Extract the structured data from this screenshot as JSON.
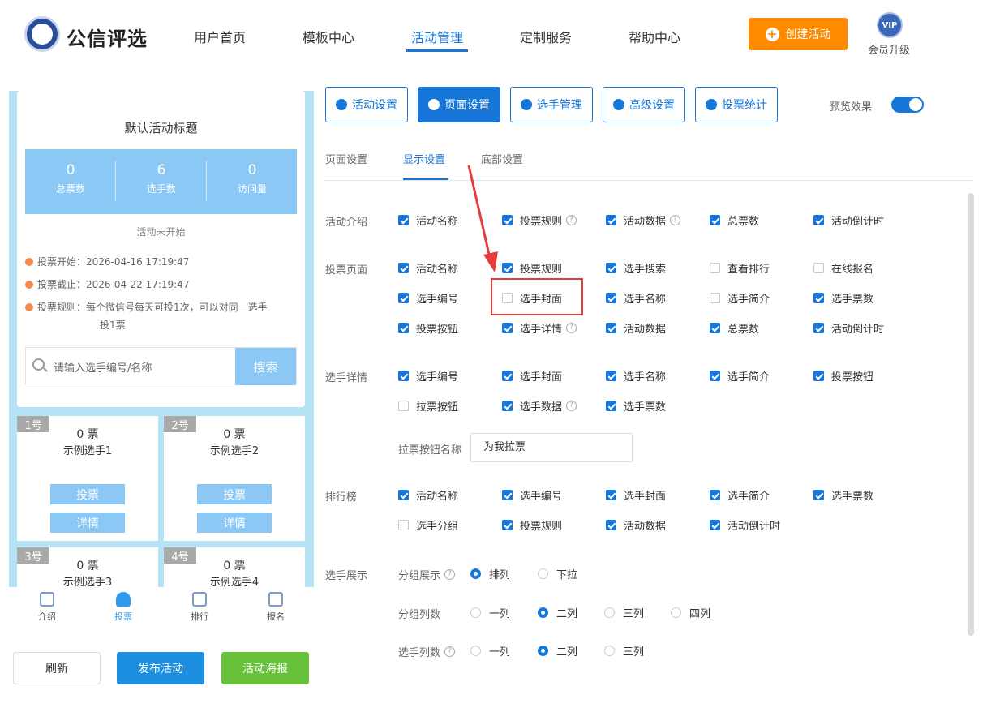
{
  "header": {
    "logo_text": "公信评选",
    "nav": [
      "用户首页",
      "模板中心",
      "活动管理",
      "定制服务",
      "帮助中心"
    ],
    "create_button": "创建活动",
    "vip_badge": "VIP",
    "vip_label": "会员升级"
  },
  "preview": {
    "title": "默认活动标题",
    "stats": [
      {
        "num": "0",
        "label": "总票数"
      },
      {
        "num": "6",
        "label": "选手数"
      },
      {
        "num": "0",
        "label": "访问量"
      }
    ],
    "status": "活动未开始",
    "vote_start": "投票开始：2026-04-16 17:19:47",
    "vote_end": "投票截止：2026-04-22 17:19:47",
    "vote_rule_1": "投票规则：每个微信号每天可投1次，可以对同一选手",
    "vote_rule_2": "投1票",
    "search_placeholder": "请输入选手编号/名称",
    "search_button": "搜索",
    "players": [
      {
        "num": "1号",
        "votes": "0 票",
        "name": "示例选手1",
        "vote_btn": "投票",
        "detail_btn": "详情"
      },
      {
        "num": "2号",
        "votes": "0 票",
        "name": "示例选手2",
        "vote_btn": "投票",
        "detail_btn": "详情"
      },
      {
        "num": "3号",
        "votes": "0 票",
        "name": "示例选手3"
      },
      {
        "num": "4号",
        "votes": "0 票",
        "name": "示例选手4"
      }
    ],
    "tabbar": [
      "介绍",
      "投票",
      "排行",
      "报名"
    ]
  },
  "bottom_buttons": {
    "refresh": "刷新",
    "publish": "发布活动",
    "poster": "活动海报"
  },
  "top_tabs": [
    "活动设置",
    "页面设置",
    "选手管理",
    "高级设置",
    "投票统计"
  ],
  "preview_toggle": {
    "label": "预览效果",
    "on": true
  },
  "sub_tabs": [
    "页面设置",
    "显示设置",
    "底部设置"
  ],
  "sections": {
    "activity_intro": {
      "label": "活动介绍",
      "items": [
        {
          "label": "活动名称",
          "checked": true
        },
        {
          "label": "投票规则",
          "checked": true,
          "help": true
        },
        {
          "label": "活动数据",
          "checked": true,
          "help": true
        },
        {
          "label": "总票数",
          "checked": true
        },
        {
          "label": "活动倒计时",
          "checked": true
        }
      ]
    },
    "vote_page": {
      "label": "投票页面",
      "items": [
        {
          "label": "活动名称",
          "checked": true
        },
        {
          "label": "投票规则",
          "checked": true
        },
        {
          "label": "选手搜索",
          "checked": true
        },
        {
          "label": "查看排行",
          "checked": false
        },
        {
          "label": "在线报名",
          "checked": false
        },
        {
          "label": "选手编号",
          "checked": true
        },
        {
          "label": "选手封面",
          "checked": false
        },
        {
          "label": "选手名称",
          "checked": true
        },
        {
          "label": "选手简介",
          "checked": false
        },
        {
          "label": "选手票数",
          "checked": true
        },
        {
          "label": "投票按钮",
          "checked": true
        },
        {
          "label": "选手详情",
          "checked": true,
          "help": true
        },
        {
          "label": "活动数据",
          "checked": true
        },
        {
          "label": "总票数",
          "checked": true
        },
        {
          "label": "活动倒计时",
          "checked": true
        }
      ]
    },
    "player_detail": {
      "label": "选手详情",
      "items": [
        {
          "label": "选手编号",
          "checked": true
        },
        {
          "label": "选手封面",
          "checked": true
        },
        {
          "label": "选手名称",
          "checked": true
        },
        {
          "label": "选手简介",
          "checked": true
        },
        {
          "label": "投票按钮",
          "checked": true
        },
        {
          "label": "拉票按钮",
          "checked": false
        },
        {
          "label": "选手数据",
          "checked": true,
          "help": true
        },
        {
          "label": "选手票数",
          "checked": true
        }
      ],
      "canvass_label": "拉票按钮名称",
      "canvass_value": "为我拉票"
    },
    "ranking": {
      "label": "排行榜",
      "items": [
        {
          "label": "活动名称",
          "checked": true
        },
        {
          "label": "选手编号",
          "checked": true
        },
        {
          "label": "选手封面",
          "checked": true
        },
        {
          "label": "选手简介",
          "checked": true
        },
        {
          "label": "选手票数",
          "checked": true
        },
        {
          "label": "选手分组",
          "checked": false
        },
        {
          "label": "投票规则",
          "checked": true
        },
        {
          "label": "活动数据",
          "checked": true
        },
        {
          "label": "活动倒计时",
          "checked": true
        }
      ]
    },
    "player_display": {
      "label": "选手展示",
      "group_display": {
        "label": "分组展示",
        "options": [
          "排列",
          "下拉"
        ],
        "selected": 0
      },
      "group_columns": {
        "label": "分组列数",
        "options": [
          "一列",
          "二列",
          "三列",
          "四列"
        ],
        "selected": 1
      },
      "player_columns": {
        "label": "选手列数",
        "options": [
          "一列",
          "二列",
          "三列"
        ],
        "selected": 1
      }
    }
  },
  "colors": {
    "primary": "#1677d8",
    "orange": "#ff8a00",
    "green": "#67c23a",
    "light_blue": "#8cc8f6",
    "highlight": "#e53d3d"
  }
}
